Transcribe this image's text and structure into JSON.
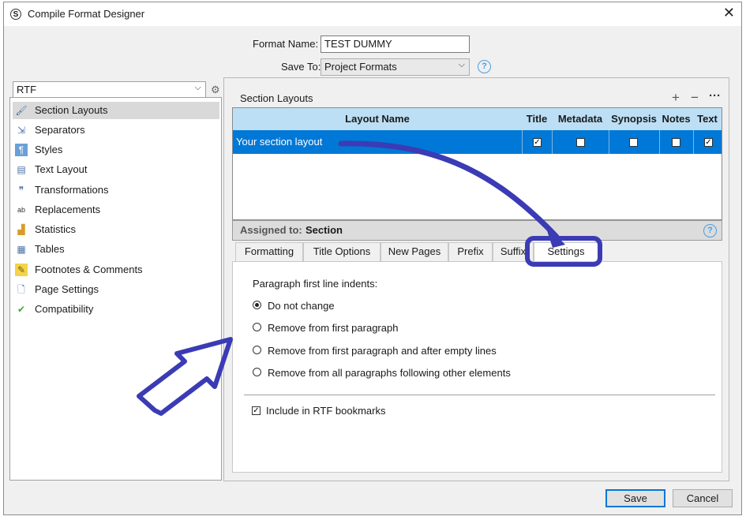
{
  "window": {
    "title": "Compile Format Designer"
  },
  "format": {
    "name_label": "Format Name:",
    "name_value": "TEST DUMMY",
    "save_to_label": "Save To:",
    "save_to_value": "Project Formats"
  },
  "sidebar": {
    "format_type": "RTF",
    "items": [
      {
        "label": "Section Layouts",
        "icon": "brush-icon",
        "selected": true
      },
      {
        "label": "Separators",
        "icon": "separator-icon"
      },
      {
        "label": "Styles",
        "icon": "paragraph-icon"
      },
      {
        "label": "Text Layout",
        "icon": "text-layout-icon"
      },
      {
        "label": "Transformations",
        "icon": "quotes-icon"
      },
      {
        "label": "Replacements",
        "icon": "ab-ac-icon"
      },
      {
        "label": "Statistics",
        "icon": "bar-chart-icon"
      },
      {
        "label": "Tables",
        "icon": "table-icon"
      },
      {
        "label": "Footnotes & Comments",
        "icon": "comment-icon"
      },
      {
        "label": "Page Settings",
        "icon": "page-icon"
      },
      {
        "label": "Compatibility",
        "icon": "check-badge-icon"
      }
    ]
  },
  "section_layouts": {
    "title": "Section Layouts",
    "columns": [
      "Layout Name",
      "Title",
      "Metadata",
      "Synopsis",
      "Notes",
      "Text"
    ],
    "rows": [
      {
        "name": "Your section layout",
        "title": true,
        "metadata": false,
        "synopsis": false,
        "notes": false,
        "text": true
      }
    ],
    "assigned_label": "Assigned to:",
    "assigned_value": "Section"
  },
  "tabs": [
    "Formatting",
    "Title Options",
    "New Pages",
    "Prefix",
    "Suffix",
    "Settings"
  ],
  "active_tab": "Settings",
  "settings": {
    "indent_label": "Paragraph first line indents:",
    "options": [
      "Do not change",
      "Remove from first paragraph",
      "Remove from first paragraph and after empty lines",
      "Remove from all paragraphs following other elements"
    ],
    "selected_option": "Do not change",
    "bookmarks_label": "Include in RTF bookmarks",
    "bookmarks_checked": true
  },
  "buttons": {
    "save": "Save",
    "cancel": "Cancel"
  },
  "colors": {
    "selection": "#0078d7",
    "header": "#bcdff5",
    "annotation": "#3b3bb5"
  }
}
